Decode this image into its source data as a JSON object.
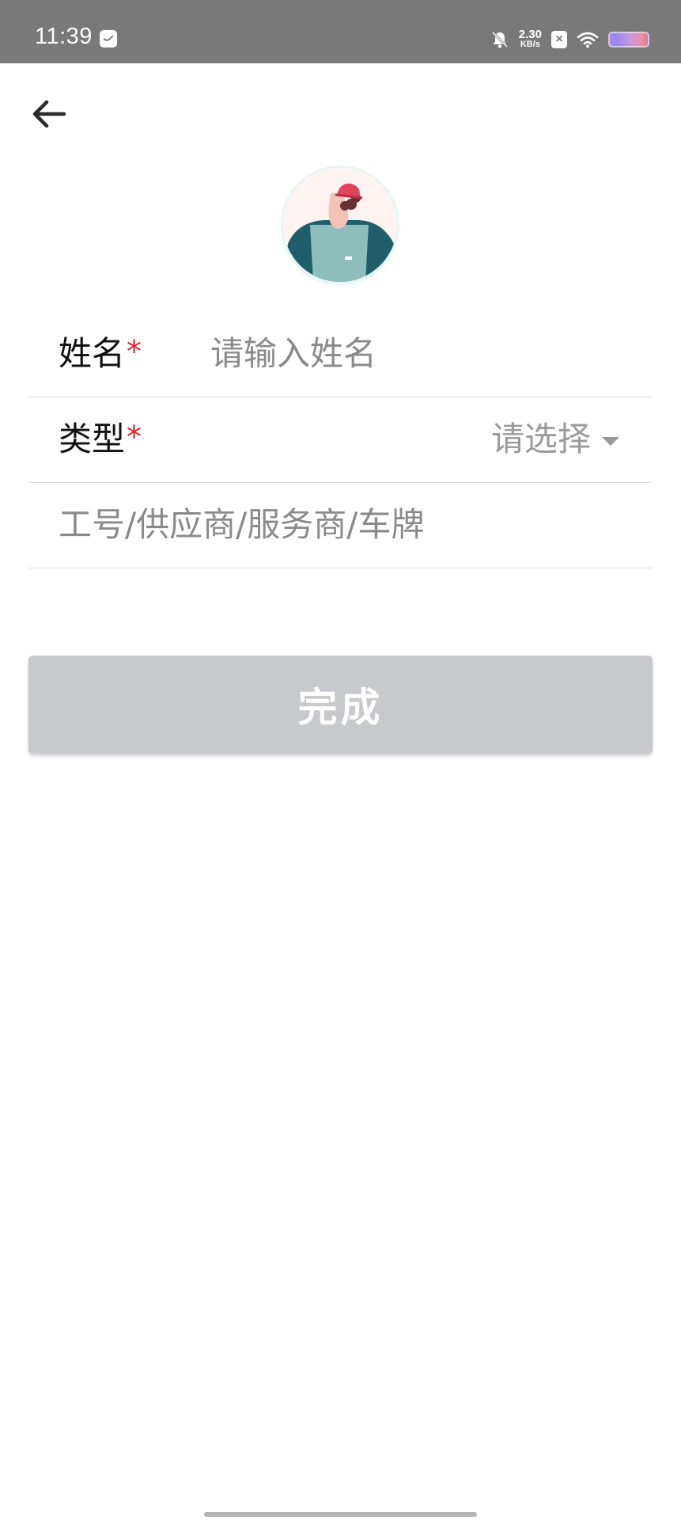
{
  "status_bar": {
    "time": "11:39",
    "net_speed_value": "2.30",
    "net_speed_unit": "KB/s",
    "icons": [
      "message-icon",
      "bell-off-icon",
      "sim-x-icon",
      "wifi-icon",
      "battery-icon"
    ]
  },
  "header": {
    "back_icon": "arrow-left-icon"
  },
  "form": {
    "name": {
      "label": "姓名",
      "required_mark": "*",
      "placeholder": "请输入姓名",
      "value": ""
    },
    "type": {
      "label": "类型",
      "required_mark": "*",
      "value": "请选择",
      "icon": "caret-down-icon"
    },
    "id": {
      "placeholder": "工号/供应商/服务商/车牌",
      "value": ""
    }
  },
  "actions": {
    "done_label": "完成"
  },
  "colors": {
    "status_bar": "#797979",
    "required": "#e5202c",
    "button_disabled": "#c8c9cc",
    "divider": "#dcdcdc"
  }
}
